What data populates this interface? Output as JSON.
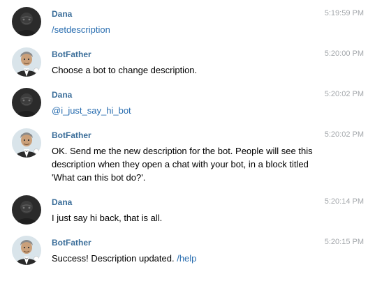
{
  "colors": {
    "sender_name": "#3a6d99",
    "timestamp": "#a3a7ab",
    "command_link": "#2a6eb0",
    "background": "#ffffff"
  },
  "messages": [
    {
      "sender": "Dana",
      "avatar_icon": "dark-profile-photo-icon",
      "time": "5:19:59 PM",
      "command": "/setdescription"
    },
    {
      "sender": "BotFather",
      "avatar_icon": "botfather-avatar-icon",
      "time": "5:20:00 PM",
      "text": "Choose a bot to change description."
    },
    {
      "sender": "Dana",
      "avatar_icon": "dark-profile-photo-icon",
      "time": "5:20:02 PM",
      "mention": "@i_just_say_hi_bot"
    },
    {
      "sender": "BotFather",
      "avatar_icon": "botfather-avatar-icon",
      "time": "5:20:02 PM",
      "text": "OK. Send me the new description for the bot. People will see this description when they open a chat with your bot, in a block titled 'What can this bot do?'."
    },
    {
      "sender": "Dana",
      "avatar_icon": "dark-profile-photo-icon",
      "time": "5:20:14 PM",
      "text": "I just say hi back, that is all."
    },
    {
      "sender": "BotFather",
      "avatar_icon": "botfather-avatar-icon",
      "time": "5:20:15 PM",
      "text": "Success! Description updated. ",
      "link": "/help"
    }
  ]
}
